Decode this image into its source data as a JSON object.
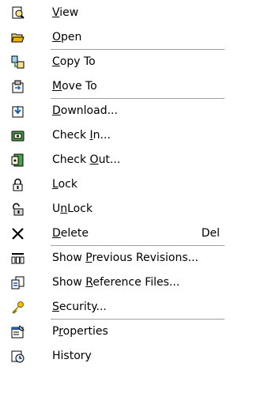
{
  "menu": {
    "items": [
      {
        "key": "view",
        "pre": "",
        "accel": "V",
        "post": "iew",
        "icon": "view-document-icon"
      },
      {
        "key": "open",
        "pre": "",
        "accel": "O",
        "post": "pen",
        "icon": "open-folder-icon"
      },
      {
        "key": "copy-to",
        "pre": "",
        "accel": "C",
        "post": "opy To",
        "icon": "copy-to-icon"
      },
      {
        "key": "move-to",
        "pre": "",
        "accel": "M",
        "post": "ove To",
        "icon": "move-to-icon"
      },
      {
        "key": "download",
        "pre": "",
        "accel": "D",
        "post": "ownload...",
        "icon": "download-icon"
      },
      {
        "key": "check-in",
        "pre": "Check ",
        "accel": "I",
        "post": "n...",
        "icon": "check-in-icon"
      },
      {
        "key": "check-out",
        "pre": "Check ",
        "accel": "O",
        "post": "ut...",
        "icon": "check-out-icon"
      },
      {
        "key": "lock",
        "pre": "",
        "accel": "L",
        "post": "ock",
        "icon": "lock-icon"
      },
      {
        "key": "unlock",
        "pre": "U",
        "accel": "n",
        "post": "Lock",
        "icon": "unlock-icon"
      },
      {
        "key": "delete",
        "pre": "",
        "accel": "D",
        "post": "elete",
        "icon": "delete-x-icon",
        "shortcut": "Del"
      },
      {
        "key": "show-previous-revisions",
        "pre": "Show ",
        "accel": "P",
        "post": "revious Revisions...",
        "icon": "revisions-icon"
      },
      {
        "key": "show-reference-files",
        "pre": "Show ",
        "accel": "R",
        "post": "eference Files...",
        "icon": "reference-files-icon"
      },
      {
        "key": "security",
        "pre": "",
        "accel": "S",
        "post": "ecurity...",
        "icon": "security-key-icon"
      },
      {
        "key": "properties",
        "pre": "P",
        "accel": "r",
        "post": "operties",
        "icon": "properties-icon"
      },
      {
        "key": "history",
        "pre": "",
        "accel": "",
        "post": "History",
        "icon": "history-icon"
      }
    ],
    "separators_after": [
      "open",
      "move-to",
      "delete",
      "security"
    ]
  }
}
